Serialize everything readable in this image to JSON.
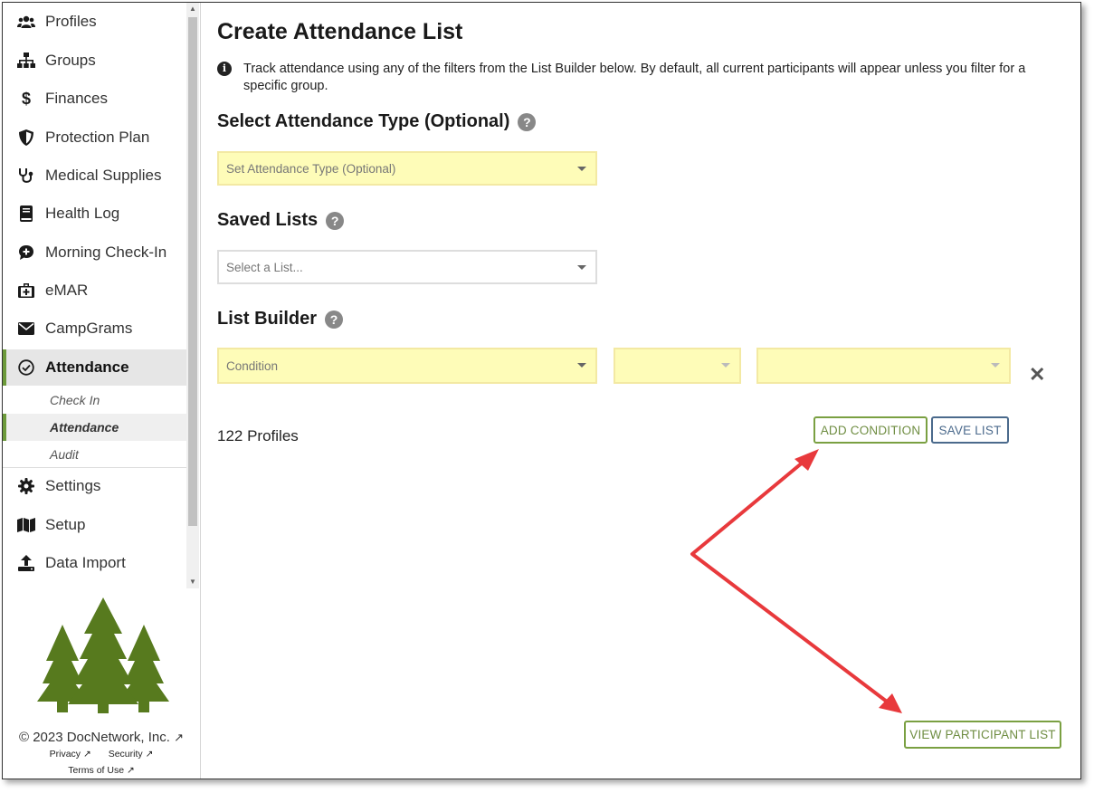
{
  "sidebar": {
    "items": [
      {
        "label": "Profiles",
        "icon": "users-icon"
      },
      {
        "label": "Groups",
        "icon": "sitemap-icon"
      },
      {
        "label": "Finances",
        "icon": "dollar-icon"
      },
      {
        "label": "Protection Plan",
        "icon": "shield-icon"
      },
      {
        "label": "Medical Supplies",
        "icon": "stethoscope-icon"
      },
      {
        "label": "Health Log",
        "icon": "book-icon"
      },
      {
        "label": "Morning Check-In",
        "icon": "comment-plus-icon"
      },
      {
        "label": "eMAR",
        "icon": "medkit-icon"
      },
      {
        "label": "CampGrams",
        "icon": "envelope-icon"
      },
      {
        "label": "Attendance",
        "icon": "check-circle-icon",
        "active": true
      },
      {
        "label": "Settings",
        "icon": "gear-icon"
      },
      {
        "label": "Setup",
        "icon": "map-icon"
      },
      {
        "label": "Data Import",
        "icon": "upload-icon"
      }
    ],
    "sub_items": [
      {
        "label": "Check In"
      },
      {
        "label": "Attendance",
        "active": true
      },
      {
        "label": "Audit"
      }
    ]
  },
  "footer": {
    "copyright": "© 2023 DocNetwork, Inc.",
    "privacy": "Privacy",
    "security": "Security",
    "terms": "Terms of Use"
  },
  "main": {
    "title": "Create Attendance List",
    "info": "Track attendance using any of the filters from the List Builder below. By default, all current participants will appear unless you filter for a specific group.",
    "attendance_type": {
      "heading": "Select Attendance Type (Optional)",
      "placeholder": "Set Attendance Type (Optional)"
    },
    "saved_lists": {
      "heading": "Saved Lists",
      "placeholder": "Select a List..."
    },
    "list_builder": {
      "heading": "List Builder",
      "condition_placeholder": "Condition",
      "operator_placeholder": "",
      "value_placeholder": ""
    },
    "profiles_count": "122 Profiles",
    "add_condition": "ADD CONDITION",
    "save_list": "SAVE LIST",
    "view_participant_list": "VIEW PARTICIPANT LIST"
  },
  "colors": {
    "accent_green": "#7aa042",
    "highlight_yellow": "#fefcb8",
    "annotation_red": "#e8393c"
  }
}
